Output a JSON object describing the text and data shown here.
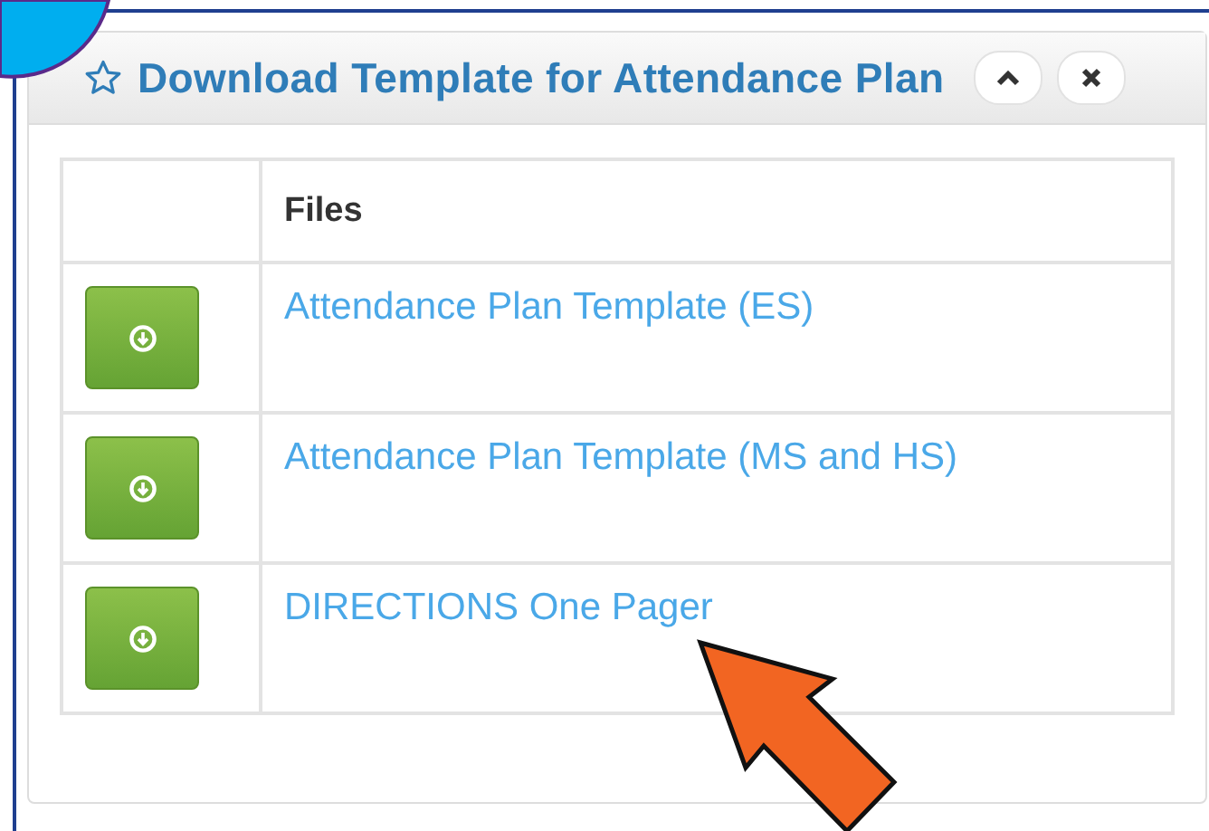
{
  "panel": {
    "title": "Download Template for Attendance Plan"
  },
  "table": {
    "columns": [
      "",
      "Files"
    ],
    "rows": [
      {
        "file": "Attendance Plan Template (ES)"
      },
      {
        "file": "Attendance Plan Template (MS and HS)"
      },
      {
        "file": "DIRECTIONS One Pager"
      }
    ]
  }
}
